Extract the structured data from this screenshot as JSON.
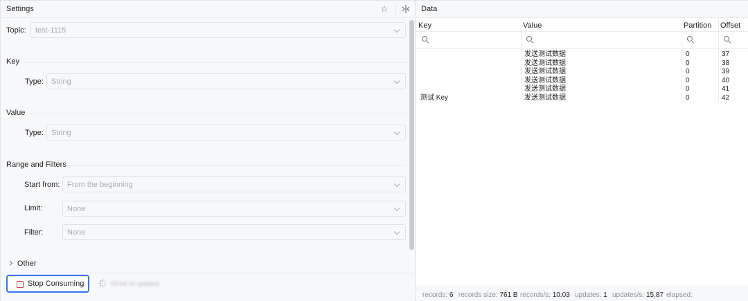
{
  "settings": {
    "title": "Settings",
    "topic": {
      "label": "Topic:",
      "value": "test-1115"
    },
    "key_section": {
      "title": "Key",
      "type_label": "Type:",
      "type_value": "String"
    },
    "value_section": {
      "title": "Value",
      "type_label": "Type:",
      "type_value": "String"
    },
    "range_section": {
      "title": "Range and Filters",
      "start_label": "Start from:",
      "start_value": "From the beginning",
      "limit_label": "Limit:",
      "limit_value": "None",
      "filter_label": "Filter:",
      "filter_value": "None"
    },
    "other_label": "Other",
    "stop_button": "Stop Consuming",
    "updated_text": "09:54:16 updated"
  },
  "data_panel": {
    "title": "Data",
    "columns": [
      "Key",
      "Value",
      "Partition",
      "Offset"
    ],
    "rows": [
      {
        "key": "",
        "value": "发送测试数据",
        "partition": "0",
        "offset": "37"
      },
      {
        "key": "",
        "value": "发送测试数据",
        "partition": "0",
        "offset": "38"
      },
      {
        "key": "",
        "value": "发送测试数据",
        "partition": "0",
        "offset": "39"
      },
      {
        "key": "",
        "value": "发送测试数据",
        "partition": "0",
        "offset": "40"
      },
      {
        "key": "",
        "value": "发送测试数据",
        "partition": "0",
        "offset": "41"
      },
      {
        "key": "测试 Key",
        "value": "发送测试数据",
        "partition": "0",
        "offset": "42"
      }
    ],
    "status": {
      "records_label": "records:",
      "records": "6",
      "size_label": "records size:",
      "size": "761 B",
      "rps_label": "records/s:",
      "rps": "10.03",
      "updates_label": "updates:",
      "updates": "1",
      "ups_label": "updates/s:",
      "ups": "15.87",
      "elapsed_label": "elapsed:"
    }
  },
  "icons": {
    "star": "star-icon",
    "split": "split-panel-icon",
    "search": "search-icon",
    "spinner": "loading-spinner-icon",
    "stop": "stop-icon"
  },
  "colors": {
    "accent": "#3574f0",
    "stop_red": "#db3b4b",
    "panel_bg": "#f7f8fa",
    "table_bg": "#ffffff"
  }
}
